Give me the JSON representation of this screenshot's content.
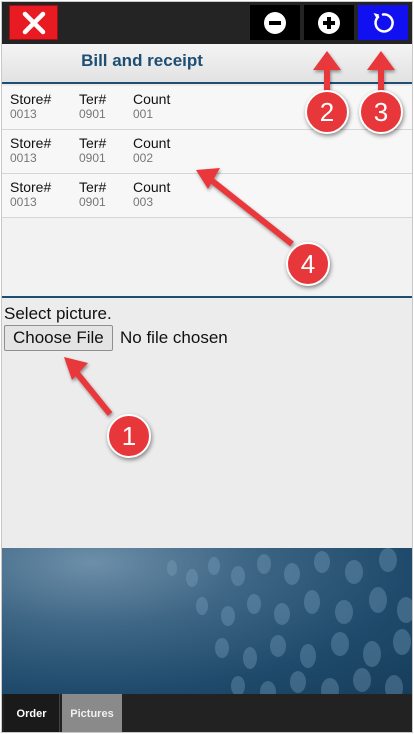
{
  "toolbar": {
    "close_icon": "close-icon",
    "minus_icon": "minus-circle-icon",
    "plus_icon": "plus-circle-icon",
    "refresh_icon": "refresh-icon",
    "close_color": "#e81b23",
    "refresh_color": "#1010f0"
  },
  "header": {
    "title": "Bill and receipt"
  },
  "list": {
    "rows": [
      {
        "store_label": "Store#",
        "store": "0013",
        "ter_label": "Ter#",
        "ter": "0901",
        "count_label": "Count",
        "count": "001"
      },
      {
        "store_label": "Store#",
        "store": "0013",
        "ter_label": "Ter#",
        "ter": "0901",
        "count_label": "Count",
        "count": "002"
      },
      {
        "store_label": "Store#",
        "store": "0013",
        "ter_label": "Ter#",
        "ter": "0901",
        "count_label": "Count",
        "count": "003"
      }
    ]
  },
  "picture": {
    "label": "Select picture.",
    "choose_button": "Choose File",
    "status": "No file chosen"
  },
  "tabs": [
    {
      "label": "Order",
      "active": false
    },
    {
      "label": "Pictures",
      "active": true
    }
  ],
  "annotations": [
    {
      "number": "1"
    },
    {
      "number": "2"
    },
    {
      "number": "3"
    },
    {
      "number": "4"
    }
  ],
  "colors": {
    "accent": "#1e4f73",
    "badge": "#e8373a"
  }
}
